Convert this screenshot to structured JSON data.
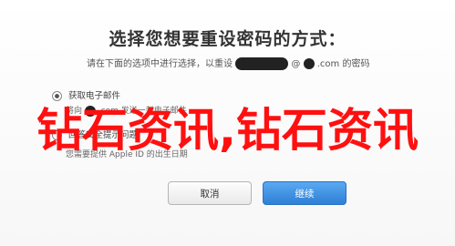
{
  "dialog": {
    "title": "选择您想要重设密码的方式：",
    "instruction_prefix": "请在下面的选项中进行选择，以重设",
    "instruction_mid": "@",
    "instruction_domain": ".com 的密码"
  },
  "options": [
    {
      "label": "获取电子邮件",
      "sub_prefix": "将向",
      "sub_suffix": ".com 发送一封电子邮件",
      "selected": true
    },
    {
      "label": "回答安全提示问题",
      "sub": "您需要提供 Apple ID 的出生日期",
      "selected": false
    }
  ],
  "watermark": "钻石资讯,钻石资讯",
  "buttons": {
    "cancel_label": "取消",
    "continue_label": "继续"
  }
}
